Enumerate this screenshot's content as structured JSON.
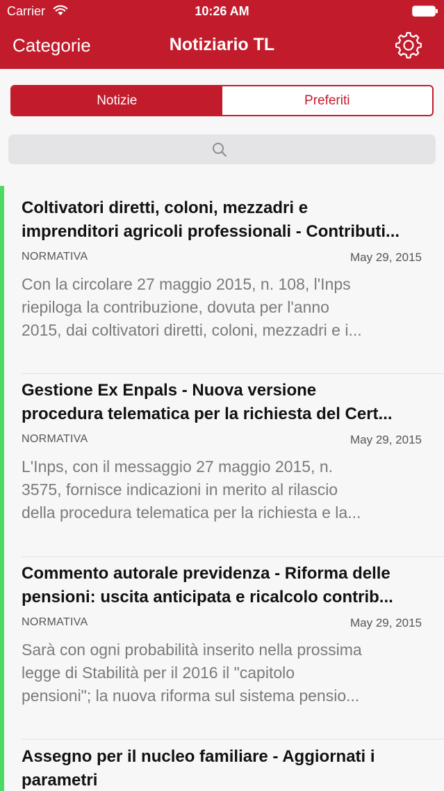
{
  "status_bar": {
    "carrier": "Carrier",
    "time": "10:26 AM"
  },
  "nav": {
    "left_button": "Categorie",
    "title": "Notiziario TL",
    "settings_icon": "gear-icon"
  },
  "segments": [
    {
      "label": "Notizie",
      "active": true
    },
    {
      "label": "Preferiti",
      "active": false
    }
  ],
  "search": {
    "icon": "search-icon"
  },
  "colors": {
    "brand": "#c21b2c",
    "accent": "#4cd964"
  },
  "articles": [
    {
      "title_lines": [
        "Coltivatori diretti, coloni, mezzadri e",
        "imprenditori agricoli professionali - Contributi..."
      ],
      "category": "NORMATIVA",
      "date": "May 29, 2015",
      "excerpt_lines": [
        "Con la circolare 27 maggio 2015, n. 108, l'Inps",
        "riepiloga la contribuzione, dovuta per l'anno",
        "2015, dai coltivatori diretti, coloni, mezzadri e i..."
      ]
    },
    {
      "title_lines": [
        "Gestione Ex Enpals - Nuova versione",
        "procedura telematica per la richiesta del Cert..."
      ],
      "category": "NORMATIVA",
      "date": "May 29, 2015",
      "excerpt_lines": [
        "L'Inps, con il messaggio 27 maggio 2015, n.",
        "3575, fornisce indicazioni in merito al rilascio",
        "della procedura telematica per la richiesta e la..."
      ]
    },
    {
      "title_lines": [
        "Commento autorale previdenza - Riforma delle",
        "pensioni: uscita anticipata e ricalcolo contrib..."
      ],
      "category": "NORMATIVA",
      "date": "May 29, 2015",
      "excerpt_lines": [
        "Sarà con ogni probabilità inserito nella prossima",
        "legge di Stabilità per il 2016 il \"capitolo",
        "pensioni\"; la nuova riforma sul sistema pensio..."
      ]
    },
    {
      "title_lines": [
        "Assegno per il nucleo familiare - Aggiornati i",
        "parametri"
      ]
    }
  ]
}
